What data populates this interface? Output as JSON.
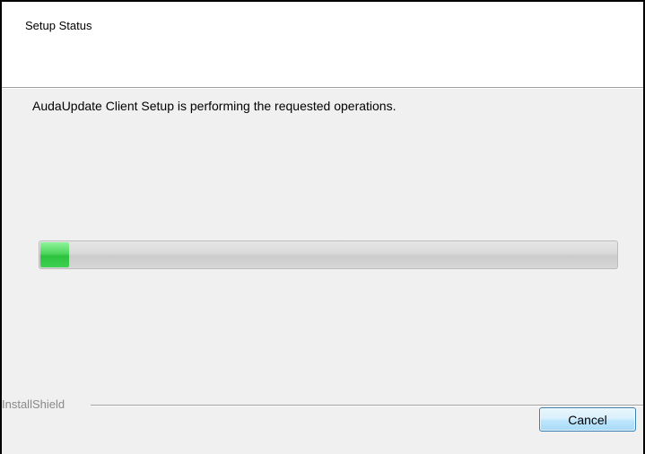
{
  "header": {
    "title": "Setup Status"
  },
  "main": {
    "status_text": "AudaUpdate Client Setup is performing the requested operations.",
    "progress": {
      "fraction": 0.05,
      "fill_color": "#3fd152"
    }
  },
  "footer": {
    "brand_label": "InstallShield",
    "cancel_label": "Cancel"
  }
}
